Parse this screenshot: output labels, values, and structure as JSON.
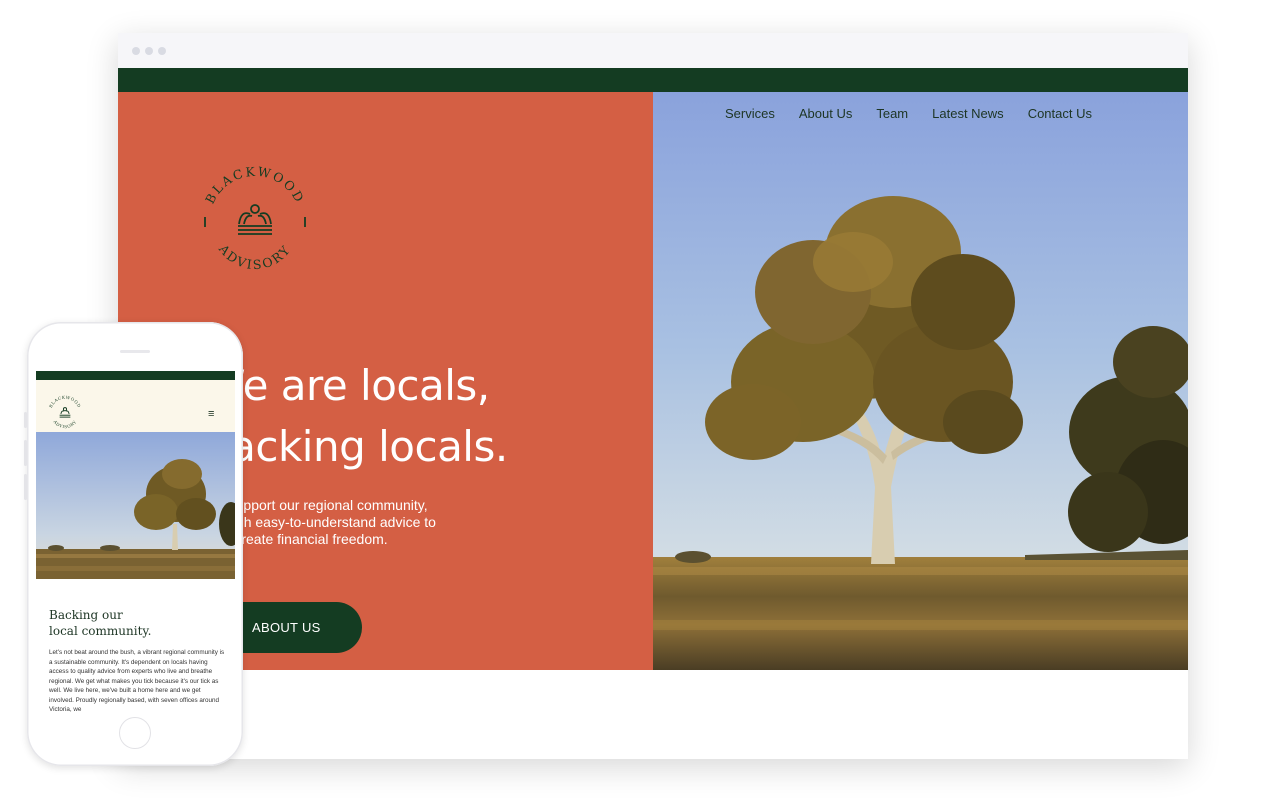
{
  "brand": {
    "name_top": "BLACKWOOD",
    "name_bottom": "ADVISORY"
  },
  "desktop": {
    "nav": [
      "Services",
      "About Us",
      "Team",
      "Latest News",
      "Contact Us"
    ],
    "headline_line1": "We are locals,",
    "headline_line2": "backing locals.",
    "subcopy": "We support our regional community, through easy-to-understand advice to help create financial freedom.",
    "cta_label": "ABOUT US"
  },
  "mobile": {
    "menu_icon": "hamburger-icon",
    "heading_line1": "Backing our",
    "heading_line2": "local community.",
    "body": "Let's not beat around the bush, a vibrant regional community is a sustainable community. It's dependent on locals having access to quality advice from experts who live and breathe regional. We get what makes you tick because it's our tick as well. We live here, we've built a home here and we get involved. Proudly regionally based, with seven offices around Victoria, we"
  },
  "colors": {
    "terracotta": "#d45f44",
    "forest_green": "#143c22",
    "cream": "#fbf7ea",
    "text_dark": "#1d3524"
  }
}
